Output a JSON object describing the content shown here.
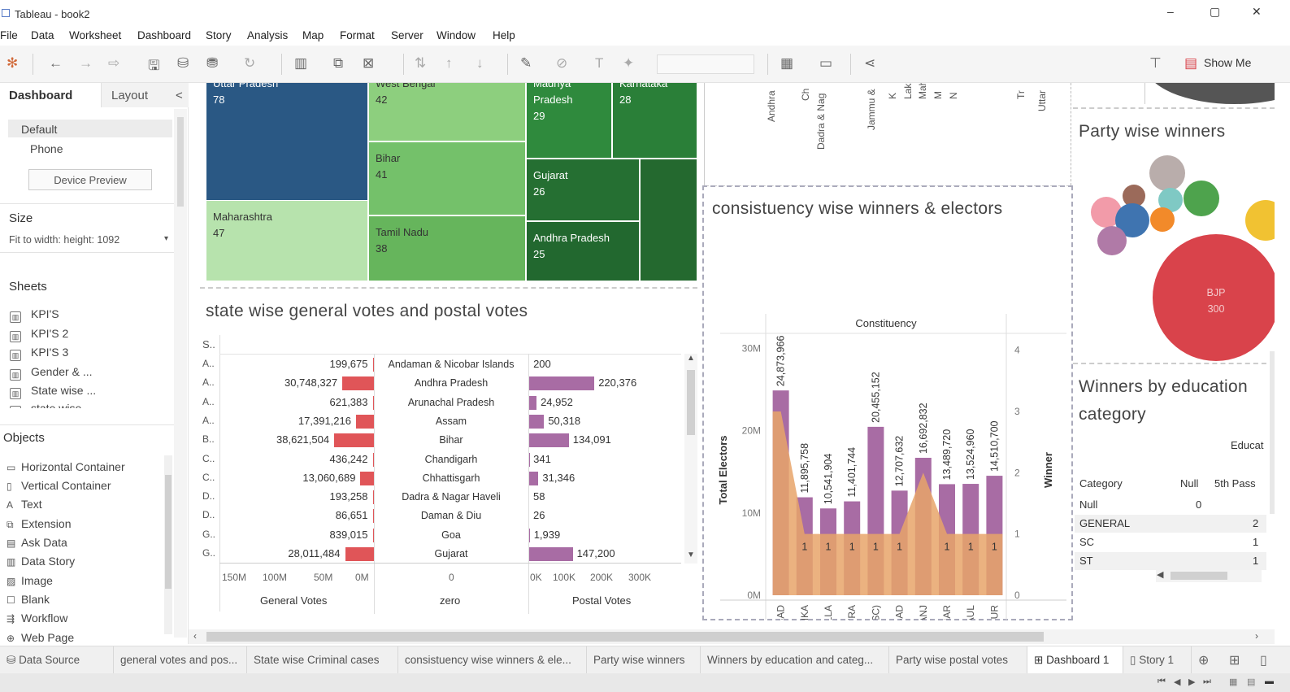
{
  "window": {
    "title": "Tableau - book2",
    "minimize": "–",
    "restore": "▢",
    "close": "✕"
  },
  "menu": [
    "File",
    "Data",
    "Worksheet",
    "Dashboard",
    "Story",
    "Analysis",
    "Map",
    "Format",
    "Server",
    "Window",
    "Help"
  ],
  "toolbar": {
    "show_me": "Show Me"
  },
  "left_panel": {
    "tab_dashboard": "Dashboard",
    "tab_layout": "Layout",
    "collapse": "<",
    "device_default": "Default",
    "device_phone": "Phone",
    "device_preview": "Device Preview",
    "size_title": "Size",
    "size_value": "Fit to width: height: 1092",
    "sheets_title": "Sheets",
    "sheets": [
      "KPI'S",
      "KPI'S 2",
      "KPI'S 3",
      "Gender & ...",
      "State wise ...",
      "state wise"
    ],
    "objects_title": "Objects",
    "objects": [
      {
        "icon": "▭",
        "label": "Horizontal Container"
      },
      {
        "icon": "▯",
        "label": "Vertical Container"
      },
      {
        "icon": "A",
        "label": "Text"
      },
      {
        "icon": "⧉",
        "label": "Extension"
      },
      {
        "icon": "▤",
        "label": "Ask Data"
      },
      {
        "icon": "▥",
        "label": "Data Story"
      },
      {
        "icon": "▨",
        "label": "Image"
      },
      {
        "icon": "☐",
        "label": "Blank"
      },
      {
        "icon": "⇶",
        "label": "Workflow"
      },
      {
        "icon": "⊕",
        "label": "Web Page"
      }
    ]
  },
  "treemap": {
    "cells": [
      {
        "label": "Uttar Pradesh",
        "value": "78",
        "color": "#2a5884"
      },
      {
        "label": "Maharashtra",
        "value": "47",
        "color": "#b7e3ad"
      },
      {
        "label": "West Bengal",
        "value": "42",
        "color": "#8dcf7e"
      },
      {
        "label": "Bihar",
        "value": "41",
        "color": "#74c16a"
      },
      {
        "label": "Tamil Nadu",
        "value": "38",
        "color": "#66b55c"
      },
      {
        "label": "Madhya Pradesh",
        "value": "29",
        "color": "#2f8a3d"
      },
      {
        "label": "Karnataka",
        "value": "28",
        "color": "#2a7f38"
      },
      {
        "label": "Gujarat",
        "value": "26",
        "color": "#256f32"
      },
      {
        "label": "Andhra Pradesh",
        "value": "25",
        "color": "#22682f"
      }
    ]
  },
  "top_vertical_labels": [
    "Andhra",
    "Ch",
    "Dadra & Nag",
    "Jammu &",
    "K",
    "Laksl",
    "Mah",
    "M",
    "N",
    "Tr",
    "Uttar"
  ],
  "state_votes": {
    "title": "state wise general votes and postal votes",
    "col_header": "S..",
    "rows": [
      {
        "abbr": "A..",
        "state": "Andaman & Nicobar Islands",
        "general": 199675,
        "general_label": "199,675",
        "postal": 200,
        "postal_label": "200"
      },
      {
        "abbr": "A..",
        "state": "Andhra Pradesh",
        "general": 30748327,
        "general_label": "30,748,327",
        "postal": 220376,
        "postal_label": "220,376"
      },
      {
        "abbr": "A..",
        "state": "Arunachal Pradesh",
        "general": 621383,
        "general_label": "621,383",
        "postal": 24952,
        "postal_label": "24,952"
      },
      {
        "abbr": "A..",
        "state": "Assam",
        "general": 17391216,
        "general_label": "17,391,216",
        "postal": 50318,
        "postal_label": "50,318"
      },
      {
        "abbr": "B..",
        "state": "Bihar",
        "general": 38621504,
        "general_label": "38,621,504",
        "postal": 134091,
        "postal_label": "134,091"
      },
      {
        "abbr": "C..",
        "state": "Chandigarh",
        "general": 436242,
        "general_label": "436,242",
        "postal": 341,
        "postal_label": "341"
      },
      {
        "abbr": "C..",
        "state": "Chhattisgarh",
        "general": 13060689,
        "general_label": "13,060,689",
        "postal": 31346,
        "postal_label": "31,346"
      },
      {
        "abbr": "D..",
        "state": "Dadra & Nagar Haveli",
        "general": 193258,
        "general_label": "193,258",
        "postal": 58,
        "postal_label": "58"
      },
      {
        "abbr": "D..",
        "state": "Daman & Diu",
        "general": 86651,
        "general_label": "86,651",
        "postal": 26,
        "postal_label": "26"
      },
      {
        "abbr": "G..",
        "state": "Goa",
        "general": 839015,
        "general_label": "839,015",
        "postal": 1939,
        "postal_label": "1,939"
      },
      {
        "abbr": "G..",
        "state": "Gujarat",
        "general": 28011484,
        "general_label": "28,011,484",
        "postal": 147200,
        "postal_label": "147,200"
      }
    ],
    "general_axis": [
      "150M",
      "100M",
      "50M",
      "0M"
    ],
    "zero_axis": [
      "0"
    ],
    "postal_axis": [
      "0K",
      "100K",
      "200K",
      "300K"
    ],
    "general_title": "General Votes",
    "zero_title": "zero",
    "postal_title": "Postal Votes"
  },
  "chart_data": {
    "type": "bar",
    "title": "consistuency wise winners & electors",
    "column_header": "Constituency",
    "ylabel": "Total Electors",
    "y2label": "Winner",
    "ylim": [
      0,
      32000000
    ],
    "y2lim": [
      0,
      4.3
    ],
    "y_ticks": [
      "30M",
      "20M",
      "10M",
      "0M"
    ],
    "y2_ticks": [
      "4",
      "3",
      "2",
      "1",
      "0"
    ],
    "categories": [
      "AURANGABAD",
      "BANKA",
      "BARAMULLA",
      "CHATRA",
      "GAYA (SC)",
      "JAHANABAD",
      "MAHARAJGANJ",
      "SHEOHAR",
      "SUPAUL",
      "UJARPUR"
    ],
    "series": [
      {
        "values": [
          24873966,
          11895758,
          10541904,
          11401744,
          20455152,
          12707632,
          16692832,
          13489720,
          13524960,
          14510700
        ],
        "labels": [
          "24,873,966",
          "11,895,758",
          "10,541,904",
          "11,401,744",
          "20,455,152",
          "12,707,632",
          "16,692,832",
          "13,489,720",
          "13,524,960",
          "14,510,700"
        ],
        "color": "#a86ca4"
      },
      {
        "values": [
          3,
          1,
          1,
          1,
          1,
          1,
          2,
          1,
          1,
          1
        ],
        "labels": [
          "",
          "1",
          "1",
          "1",
          "1",
          "1",
          "",
          "1",
          "1",
          "1"
        ],
        "color": "#e8a46a"
      }
    ]
  },
  "party_winners": {
    "title": "Party wise winners",
    "main_label": "BJP",
    "main_value": "300"
  },
  "education": {
    "title": "Winners by education category",
    "header_top": "Educat",
    "columns": [
      "Category",
      "Null",
      "5th Pass"
    ],
    "rows": [
      {
        "category": "Null",
        "null": "0",
        "fifth": ""
      },
      {
        "category": "GENERAL",
        "null": "",
        "fifth": "2"
      },
      {
        "category": "SC",
        "null": "",
        "fifth": "1"
      },
      {
        "category": "ST",
        "null": "",
        "fifth": "1"
      }
    ]
  },
  "sheet_tabs": [
    "Data Source",
    "general votes and pos...",
    "State wise Criminal cases",
    "consistuency wise winners & ele...",
    "Party wise winners",
    "Winners by education and categ...",
    "Party wise postal votes",
    "Dashboard 1",
    "Story 1"
  ],
  "colors": {
    "general_bar": "#e05558",
    "postal_bar": "#a86ca4",
    "winner_area": "#e8a46a",
    "bjp": "#d9434b"
  }
}
